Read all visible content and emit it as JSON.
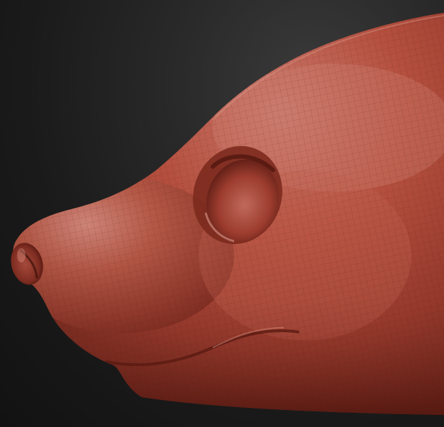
{
  "scene": {
    "subject": "sculpted-animal-head-mesh",
    "background_color": "#1a1a1a",
    "material_color": "#b34a3b",
    "material_highlight": "#d07a6c",
    "material_shadow": "#5a1d14"
  }
}
